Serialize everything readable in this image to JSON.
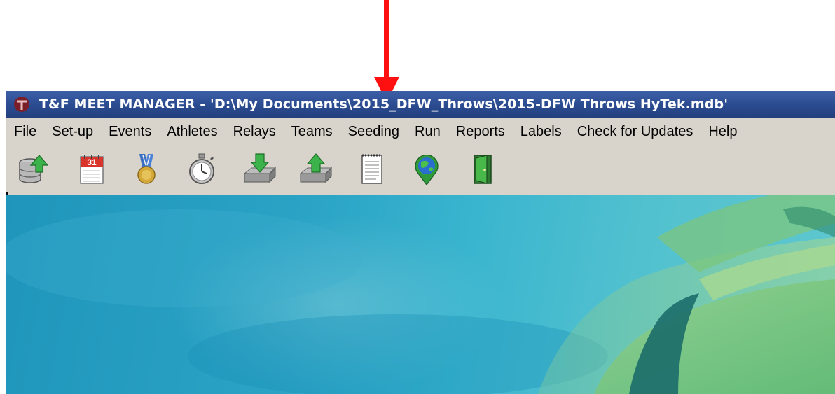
{
  "window": {
    "title": "T&F MEET MANAGER - 'D:\\My Documents\\2015_DFW_Throws\\2015-DFW Throws HyTek.mdb'",
    "accent_color": "#2b4b90"
  },
  "menu": {
    "items": [
      {
        "label": "File"
      },
      {
        "label": "Set-up"
      },
      {
        "label": "Events"
      },
      {
        "label": "Athletes"
      },
      {
        "label": "Relays"
      },
      {
        "label": "Teams"
      },
      {
        "label": "Seeding"
      },
      {
        "label": "Run"
      },
      {
        "label": "Reports"
      },
      {
        "label": "Labels"
      },
      {
        "label": "Check for Updates"
      },
      {
        "label": "Help"
      }
    ]
  },
  "toolbar": {
    "buttons": [
      {
        "icon": "database-upload-icon"
      },
      {
        "icon": "calendar-icon",
        "text": "31"
      },
      {
        "icon": "medal-icon"
      },
      {
        "icon": "stopwatch-icon"
      },
      {
        "icon": "import-tray-icon"
      },
      {
        "icon": "export-tray-icon"
      },
      {
        "icon": "notepad-icon"
      },
      {
        "icon": "globe-icon"
      },
      {
        "icon": "exit-door-icon"
      }
    ]
  },
  "annotation": {
    "arrow_color": "#ff0000"
  }
}
